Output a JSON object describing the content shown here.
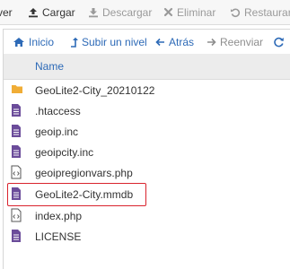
{
  "toolbar": {
    "items": [
      {
        "label": "ver",
        "icon": "chevron-down-icon",
        "state": "active"
      },
      {
        "label": "Cargar",
        "icon": "upload-icon",
        "state": "active"
      },
      {
        "label": "Descargar",
        "icon": "download-icon",
        "state": "disabled"
      },
      {
        "label": "Eliminar",
        "icon": "close-icon",
        "state": "disabled"
      },
      {
        "label": "Restaurar",
        "icon": "restore-icon",
        "state": "disabled"
      }
    ]
  },
  "nav": {
    "home": "Inicio",
    "up": "Subir un nivel",
    "back": "Atrás",
    "forward": "Reenviar",
    "reload_icon": "reload-icon"
  },
  "files": {
    "column_header": "Name",
    "rows": [
      {
        "name": "GeoLite2-City_20210122",
        "icon": "folder-icon"
      },
      {
        "name": ".htaccess",
        "icon": "file-text-icon"
      },
      {
        "name": "geoip.inc",
        "icon": "file-text-icon"
      },
      {
        "name": "geoipcity.inc",
        "icon": "file-text-icon"
      },
      {
        "name": "geoipregionvars.php",
        "icon": "file-code-icon"
      },
      {
        "name": "GeoLite2-City.mmdb",
        "icon": "file-text-icon",
        "highlighted": true
      },
      {
        "name": "index.php",
        "icon": "file-code-icon"
      },
      {
        "name": "LICENSE",
        "icon": "file-text-icon"
      }
    ]
  },
  "colors": {
    "link": "#2d6ab7",
    "file_icon": "#6b4c9a",
    "folder_icon": "#f0ad36",
    "highlight_border": "#d9232d"
  }
}
